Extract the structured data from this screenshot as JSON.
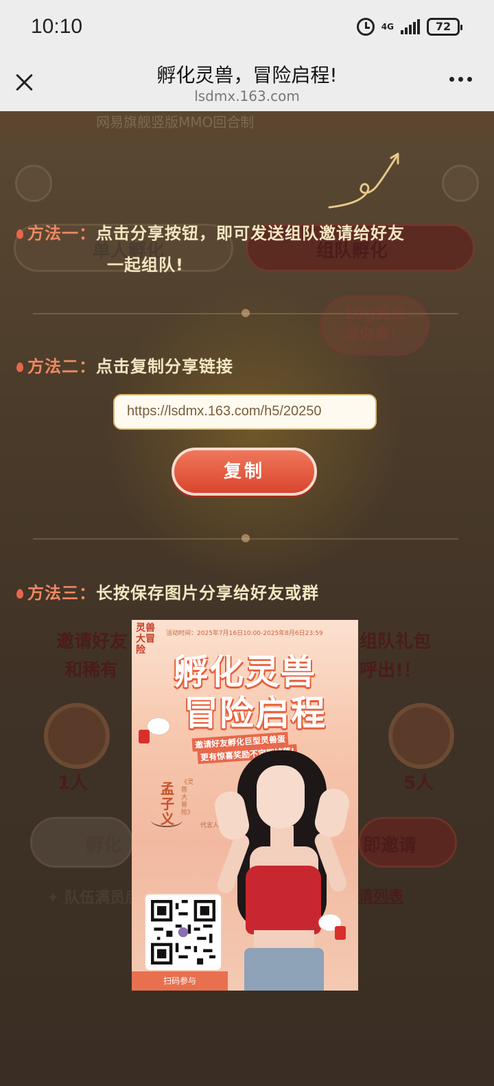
{
  "status_bar": {
    "time": "10:10",
    "network": "4G",
    "battery": "72"
  },
  "navbar": {
    "title": "孵化灵兽，冒险启程!",
    "url": "lsdmx.163.com"
  },
  "background": {
    "banner_text": "网易旗舰竖版MMO回合制",
    "single_hatch": "单人孵化",
    "team_hatch": "组队孵化",
    "ticket_line1": "10g黄金",
    "ticket_line2": "等你拿！",
    "label_1": "1人",
    "label_5": "5人",
    "invite_line1_left": "邀请好友",
    "invite_line1_right": "组队礼包",
    "invite_line2_left": "和稀有",
    "invite_line2_right": "呼出!！",
    "hatch_button": "孵化",
    "invite_now": "即邀请",
    "team_full_note": "✦ 队伍满员后",
    "invite_list": "请列表"
  },
  "methods": {
    "method1_label": "方法一：",
    "method1_text": "点击分享按钮，即可发送组队邀请给好友",
    "method1_cont": "一起组队!",
    "method2_label": "方法二：",
    "method2_text": "点击复制分享链接",
    "method3_label": "方法三：",
    "method3_text": "长按保存图片分享给好友或群"
  },
  "share": {
    "link": "https://lsdmx.163.com/h5/20250",
    "copy_button": "复制"
  },
  "poster": {
    "logo": "灵兽大冒险",
    "activity_time": "活动时间：2025年7月16日10:00-2025年8月6日23:59",
    "title_line1": "孵化灵兽",
    "title_line2": "冒险启程",
    "subtitle1": "邀请好友孵化巨型灵兽蛋",
    "subtitle2": "更有惊喜奖励不定期掉落!",
    "celebrity_name": "孟子义",
    "celebrity_role": "《灵兽大冒险》",
    "celebrity_role2": "代言人",
    "qr_caption": "扫码参与"
  },
  "colors": {
    "accent": "#e8664a",
    "method_label": "#ef8a62",
    "method_text": "#f4e7c3",
    "copy_button": "#e4573d"
  }
}
